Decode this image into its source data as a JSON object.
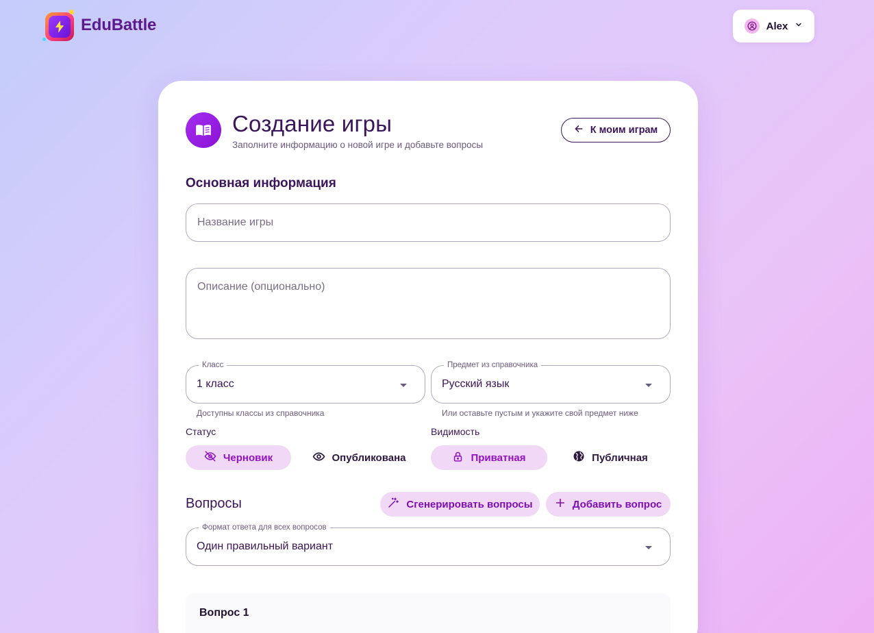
{
  "header": {
    "app_name": "EduBattle",
    "user_name": "Alex"
  },
  "page": {
    "title": "Создание игры",
    "subtitle": "Заполните информацию о новой игре и добавьте вопросы",
    "back_label": "К моим играм"
  },
  "basic_info": {
    "section_title": "Основная информация",
    "name_placeholder": "Название игры",
    "description_placeholder": "Описание (опционально)",
    "class_field": {
      "legend": "Класс",
      "value": "1 класс",
      "helper": "Доступны классы из справочника"
    },
    "subject_field": {
      "legend": "Предмет из справочника",
      "value": "Русский язык",
      "helper": "Или оставьте пустым и укажите свой предмет ниже"
    },
    "status": {
      "label": "Статус",
      "options": [
        {
          "label": "Черновик",
          "icon": "eye-off-icon",
          "active": true
        },
        {
          "label": "Опубликована",
          "icon": "eye-icon",
          "active": false
        }
      ]
    },
    "visibility": {
      "label": "Видимость",
      "options": [
        {
          "label": "Приватная",
          "icon": "lock-icon",
          "active": true
        },
        {
          "label": "Публичная",
          "icon": "globe-icon",
          "active": false
        }
      ]
    }
  },
  "questions": {
    "section_title": "Вопросы",
    "generate_label": "Сгенерировать вопросы",
    "add_label": "Добавить вопрос",
    "format_field": {
      "legend": "Формат ответа для всех вопросов",
      "value": "Один правильный вариант"
    },
    "items": [
      {
        "title": "Вопрос 1"
      }
    ]
  },
  "colors": {
    "accent": "#9213bf",
    "accent_bg": "#f1d8f6",
    "text_dark": "#3b1559"
  }
}
